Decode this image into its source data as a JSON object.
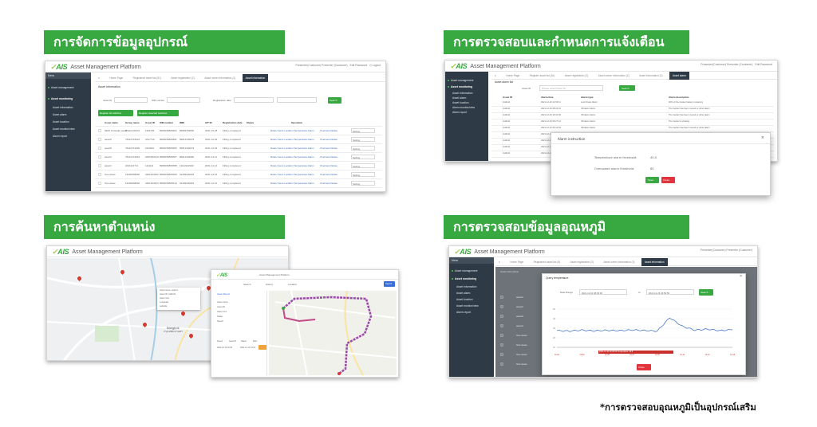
{
  "sections": {
    "asset_data": "การจัดการข้อมูลอุปกรณ์",
    "alerts": "การตรวจสอบและกำหนดการแจ้งเตือน",
    "location": "การค้นหาตำแหน่ง",
    "temperature": "การตรวจสอบข้อมูลอุณหภูมิ"
  },
  "footnote": "*การตรวจสอบอุณหภูมิเป็นอุปกรณ์เสริม",
  "app": {
    "brand": "AIS",
    "title": "Asset Management Platform",
    "header_user": "Presenter(Customer) Presenter (Customer)",
    "change_password": "Edit Password",
    "logout": "Logout"
  },
  "s1": {
    "menu_label": "Menu",
    "sidebar": [
      "Asset management",
      "Asset monitoring",
      "Asset information",
      "Asset alarm",
      "Asset location",
      "Asset monitor/view",
      "Alarm report"
    ],
    "tabs": [
      "Home Page",
      "Registered asset list (51)",
      "Asset registration (2)",
      "Asset owner information (2)",
      "Asset information"
    ],
    "content_title": "Asset information",
    "filters": [
      "Asset ID",
      "SIM number",
      "Registration date"
    ],
    "search": "Search",
    "btn_add": "Register all switches",
    "btn_add_selected": "Register selected switches",
    "columns": [
      "Asset name",
      "Group name",
      "Asset ID",
      "SIM number",
      "IMEI",
      "AIT ID",
      "Registration date",
      "Status",
      "Operation"
    ],
    "rows": [
      [
        "NEW Crusader asset",
        "BSHC232221",
        "1119706",
        "8966036866602",
        "86809769500",
        "2021-10-28",
        "Filling completed"
      ],
      [
        "asset5",
        "76210718401",
        "3417716",
        "8966036866581",
        "86812345678",
        "2021-12-02",
        "Filling completed"
      ],
      [
        "asset8",
        "76210719400",
        "2110000",
        "8966036866583",
        "86812345679",
        "2021-12-03",
        "Filling completed"
      ],
      [
        "asset3",
        "76210718491",
        "3461583416",
        "8966036866587",
        "86812345680",
        "2021-12-11",
        "Filling completed"
      ],
      [
        "asset1",
        "2021121711",
        "1111111",
        "8966036866588",
        "11112222333",
        "2021-12-14",
        "Filling completed"
      ],
      [
        "Test asset",
        "13400068990",
        "4361493452",
        "8966036866509",
        "42409340052",
        "2021-12-16",
        "Filling completed"
      ],
      [
        "Test asset",
        "13400068990",
        "4361493453",
        "8966036866510",
        "42409340053",
        "2021-12-21",
        "Filling completed"
      ]
    ],
    "ops": "Rules  Users  Location  Temperature  Alarm",
    "ops2": "Overview  Delete",
    "setting": "Setting"
  },
  "s2": {
    "sidebar": [
      "Asset management",
      "Asset monitoring",
      "Asset information",
      "Asset alarm",
      "Asset location",
      "Alarm monitor/view",
      "Alarm report"
    ],
    "tabs": [
      "Home Page",
      "Register asset list (51)",
      "Asset registration (2)",
      "Asset owner information (2)",
      "Asset information (2)",
      "Asset alarm"
    ],
    "content_title": "Asset alarm list",
    "filter_label": "Asset ID",
    "filter_placeholder": "Please select Asset ID",
    "search": "Search",
    "columns": [
      "Asset ID",
      "Alarm time",
      "Alarm type",
      "Alarm description"
    ],
    "rows": [
      [
        "1111111",
        "2021-12-16 12:30:11",
        "Low Power Alarm",
        "20% of the tracker battery remaining"
      ],
      [
        "1111111",
        "2021-12-16 08:22:10",
        "Vibration Alarm",
        "The tracker has been moved or other alarm"
      ],
      [
        "1111111",
        "2021-12-15 19:10:00",
        "Vibration Alarm",
        "The tracker has been moved or other alarm"
      ],
      [
        "1111111",
        "2021-12-15 09:27:12",
        "Vibration Alarm",
        "The tracker is shaking"
      ],
      [
        "1111111",
        "2021-12-14 06:12:54",
        "Vibration Alarm",
        "The tracker has been moved or other alarm"
      ],
      [
        "1111111",
        "2021-12-14 04:15:12",
        "Vibration Alarm",
        "The tracker is shaking"
      ],
      [
        "1111111",
        "2021-12-13 14:00:20",
        "Vibration Alarm",
        "The tracker is shaking"
      ],
      [
        "1111111",
        "2021-12-12 07:20:10",
        "Vibration Alarm",
        "The tracker is shaking"
      ],
      [
        "1111111",
        "2021-12-11 05:40:33",
        "Vibration Alarm",
        "The tracker is shaking"
      ]
    ],
    "modal": {
      "title": "Alarm instruction",
      "temp_label": "Temperature alarm threshold:",
      "temp_value": "40.0",
      "over_label": "Overspeed alarm threshold:",
      "over_value": "80",
      "save": "Save",
      "close": "Close"
    }
  },
  "s3": {
    "popup_lines": [
      "Asset name: asset1",
      "Asset ID: 1111111",
      "Alarm time",
      "Longitude",
      "Latitude"
    ],
    "map_labels": [
      "Bangkok",
      "กรุงเทพมหานคร"
    ],
    "panel_title": "Asset Management Platform",
    "panel_tabs": [
      "Search",
      "History",
      "Location"
    ],
    "panel_search": "Search",
    "panel_fields": [
      "Asset Report",
      "Asset name",
      "Asset ID",
      "Alarm time",
      "Status",
      "Speed"
    ],
    "panel_list_head": [
      "Speed",
      "Asset ID",
      "Status",
      "Date"
    ],
    "panel_list": [
      "2021-12-13 10:35",
      "2021-12-14 10:33"
    ]
  },
  "s4": {
    "sidebar": [
      "Asset management",
      "Asset monitoring",
      "Asset information",
      "Asset alarm",
      "Asset location",
      "Asset monitor/view",
      "Alarm report"
    ],
    "tabs": [
      "Home Page",
      "Registered asset list (8)",
      "Asset registration (2)",
      "Asset owner information (3)",
      "Asset information"
    ],
    "content_title": "Asset information",
    "modal_title": "Query temperature",
    "date_label": "Date Range",
    "date_from": "2021-12-01 08:00:00",
    "date_to": "2021-12-15 23:59:59",
    "search": "Search",
    "close": "Close",
    "chart_note": "2021-12-14 02:00:00 Temperature: 40.6",
    "chart_data": {
      "type": "line",
      "x": [
        "12-01",
        "12-02",
        "12-03",
        "12-04",
        "12-05",
        "12-06",
        "12-07",
        "12-08",
        "12-09",
        "12-10",
        "12-11",
        "12-12",
        "12-13",
        "12-14",
        "12-15"
      ],
      "series": [
        {
          "values": [
            27.5,
            27.0,
            28.0,
            27.2,
            27.8,
            27.4,
            28.2,
            27.6,
            27.0,
            41.0,
            32.0,
            28.0,
            29.0,
            27.5,
            28.4
          ]
        }
      ],
      "ylim": [
        10,
        50
      ]
    },
    "rows": [
      "asset1",
      "asset2",
      "asset3",
      "asset4",
      "Test asset",
      "Test asset",
      "Test asset",
      "Test asset"
    ]
  }
}
